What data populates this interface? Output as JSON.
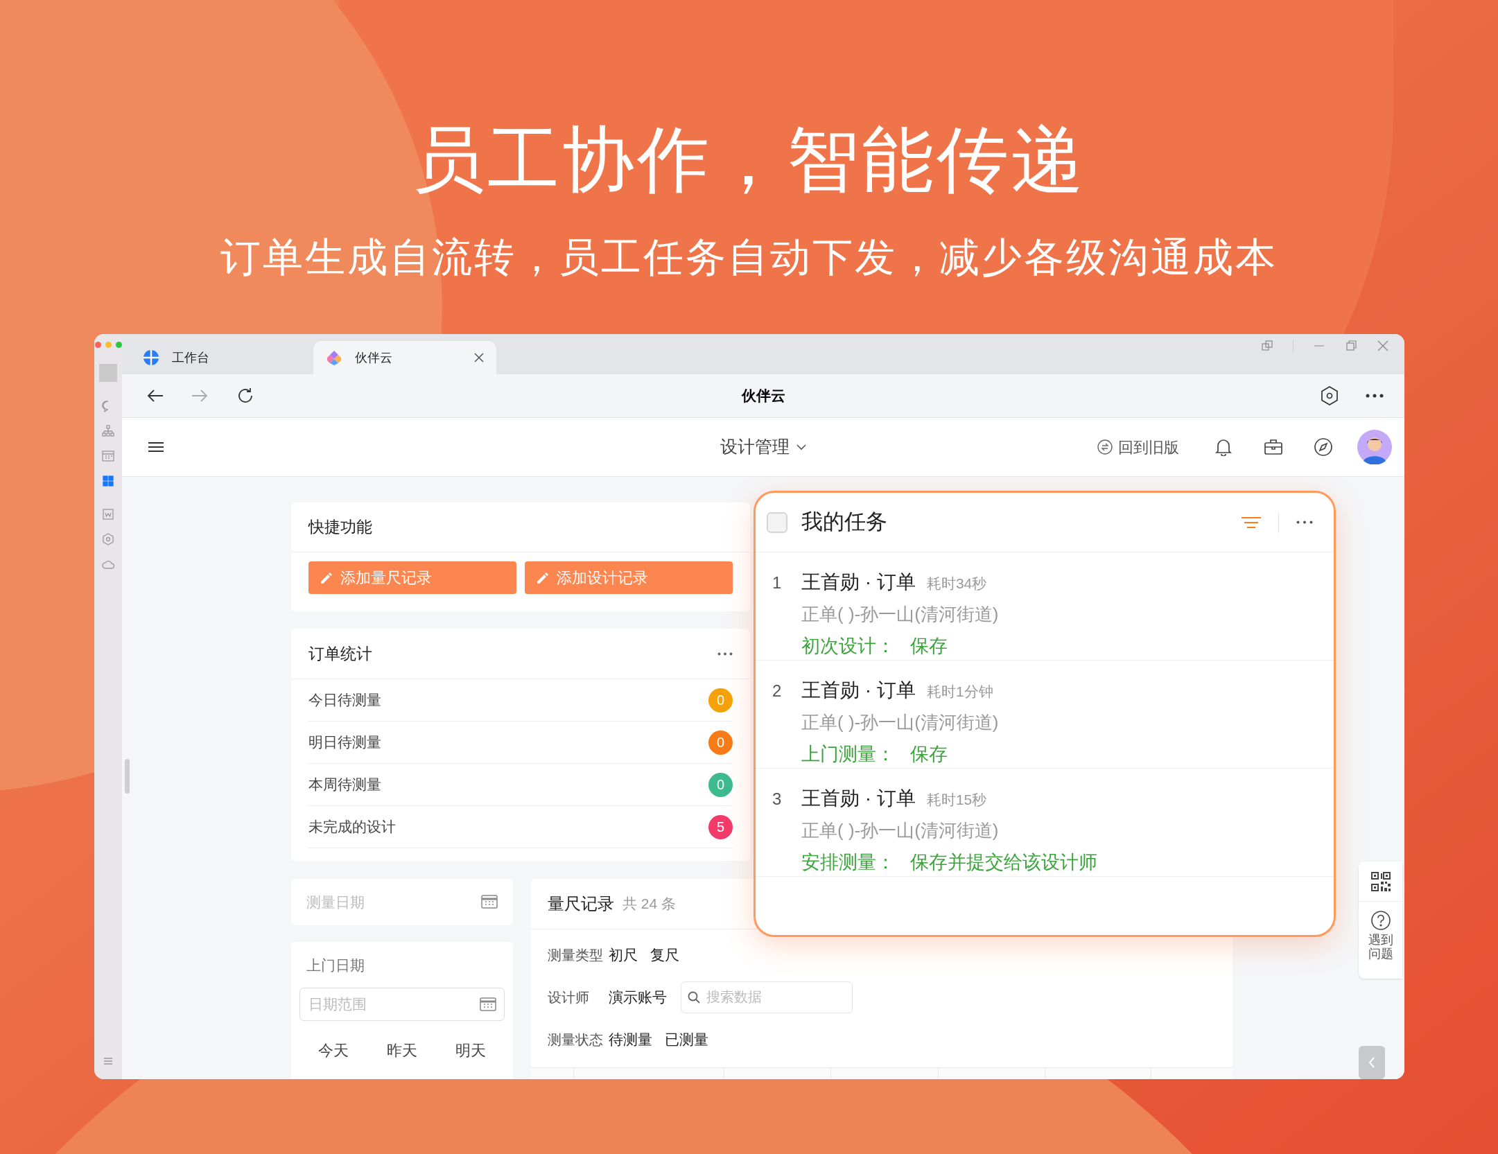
{
  "headline": "员工协作，智能传递",
  "subheadline": "订单生成自流转，员工任务自动下发，减少各级沟通成本",
  "sidebar": {
    "items": [
      {
        "selected": false
      },
      {
        "selected": false
      },
      {
        "selected": false
      },
      {
        "selected": true
      },
      {
        "selected": false
      },
      {
        "selected": false
      },
      {
        "selected": false
      }
    ]
  },
  "window": {
    "tabs": [
      {
        "label": "工作台",
        "selected": false
      },
      {
        "label": "伙伴云",
        "selected": true
      }
    ],
    "title": "伙伴云"
  },
  "app_header": {
    "module": "设计管理",
    "back_to_old": "回到旧版"
  },
  "quick_actions": {
    "title": "快捷功能",
    "buttons": [
      "添加量尺记录",
      "添加设计记录"
    ]
  },
  "order_stats": {
    "title": "订单统计",
    "rows": [
      {
        "label": "今日待测量",
        "count": "0",
        "color": "#f5a20a"
      },
      {
        "label": "明日待测量",
        "count": "0",
        "color": "#f77b17"
      },
      {
        "label": "本周待测量",
        "count": "0",
        "color": "#3dba8e"
      },
      {
        "label": "未完成的设计",
        "count": "5",
        "color": "#f23a6b"
      }
    ]
  },
  "measure_date": {
    "placeholder": "测量日期"
  },
  "visit_date": {
    "label": "上门日期",
    "placeholder": "日期范围",
    "quick": [
      "今天",
      "昨天",
      "明天"
    ]
  },
  "records": {
    "title": "量尺记录",
    "count": "共 24 条",
    "filters": [
      {
        "label": "测量类型",
        "options": [
          "初尺",
          "复尺"
        ]
      },
      {
        "label": "设计师",
        "options": [
          "演示账号"
        ],
        "search_placeholder": "搜索数据"
      },
      {
        "label": "测量状态",
        "options": [
          "待测量",
          "已测量"
        ]
      }
    ]
  },
  "tasks": {
    "title": "我的任务",
    "checked": false,
    "items": [
      {
        "index": "1",
        "title": "王首勋 · 订单",
        "duration": "耗时34秒",
        "order": "正单( )-孙一山(清河街道)",
        "step": "初次设计：",
        "action": "保存"
      },
      {
        "index": "2",
        "title": "王首勋 · 订单",
        "duration": "耗时1分钟",
        "order": "正单( )-孙一山(清河街道)",
        "step": "上门测量：",
        "action": "保存"
      },
      {
        "index": "3",
        "title": "王首勋 · 订单",
        "duration": "耗时15秒",
        "order": "正单( )-孙一山(清河街道)",
        "step": "安排测量：",
        "action": "保存并提交给该设计师"
      }
    ]
  },
  "help": {
    "label": "遇到问题"
  }
}
